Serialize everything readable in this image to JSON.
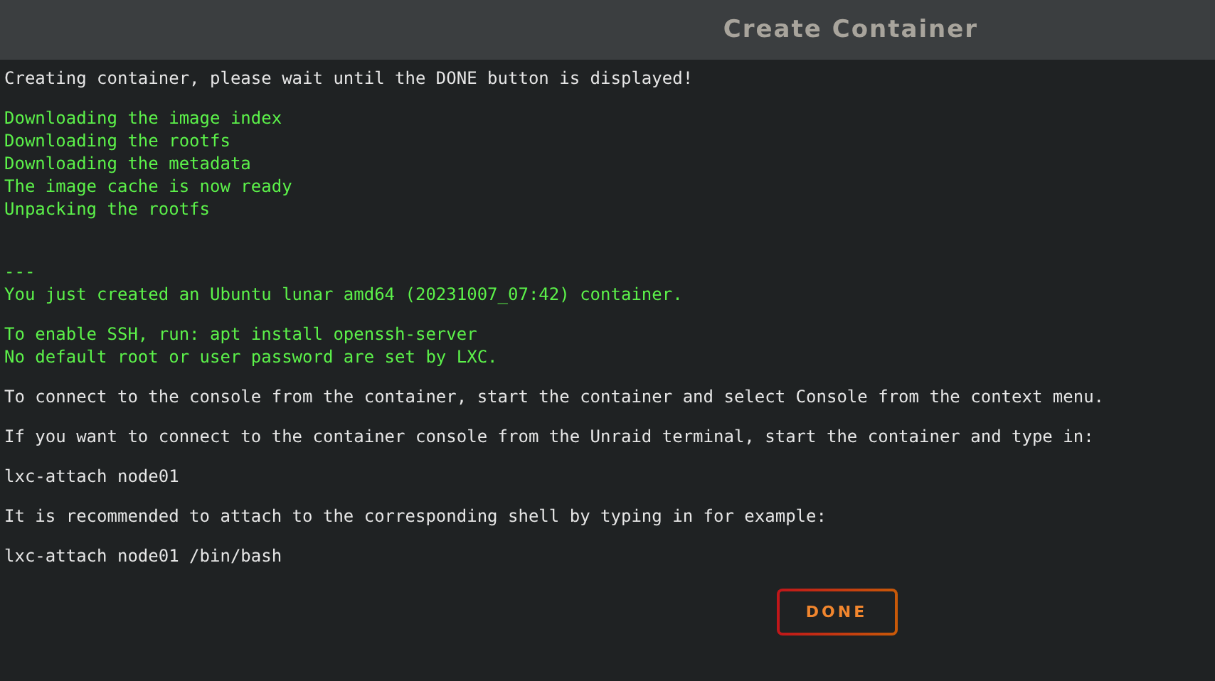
{
  "window": {
    "title": "Create Container"
  },
  "log": [
    {
      "kind": "plain",
      "lines": [
        "Creating container, please wait until the DONE button is displayed!"
      ]
    },
    {
      "kind": "green",
      "lines": [
        "Downloading the image index",
        "Downloading the rootfs",
        "Downloading the metadata",
        "The image cache is now ready",
        "Unpacking the rootfs"
      ]
    },
    {
      "kind": "green",
      "lines": [
        "---",
        "You just created an Ubuntu lunar amd64 (20231007_07:42) container."
      ]
    },
    {
      "kind": "green",
      "lines": [
        "To enable SSH, run: apt install openssh-server",
        "No default root or user password are set by LXC."
      ]
    },
    {
      "kind": "plain",
      "lines": [
        "To connect to the console from the container, start the container and select Console from the context menu."
      ]
    },
    {
      "kind": "plain",
      "lines": [
        "If you want to connect to the container console from the Unraid terminal, start the container and type in:"
      ]
    },
    {
      "kind": "plain",
      "lines": [
        "lxc-attach node01"
      ]
    },
    {
      "kind": "plain",
      "lines": [
        "It is recommended to attach to the corresponding shell by typing in for example:"
      ]
    },
    {
      "kind": "plain",
      "lines": [
        "lxc-attach node01 /bin/bash"
      ]
    }
  ],
  "button": "DONE"
}
